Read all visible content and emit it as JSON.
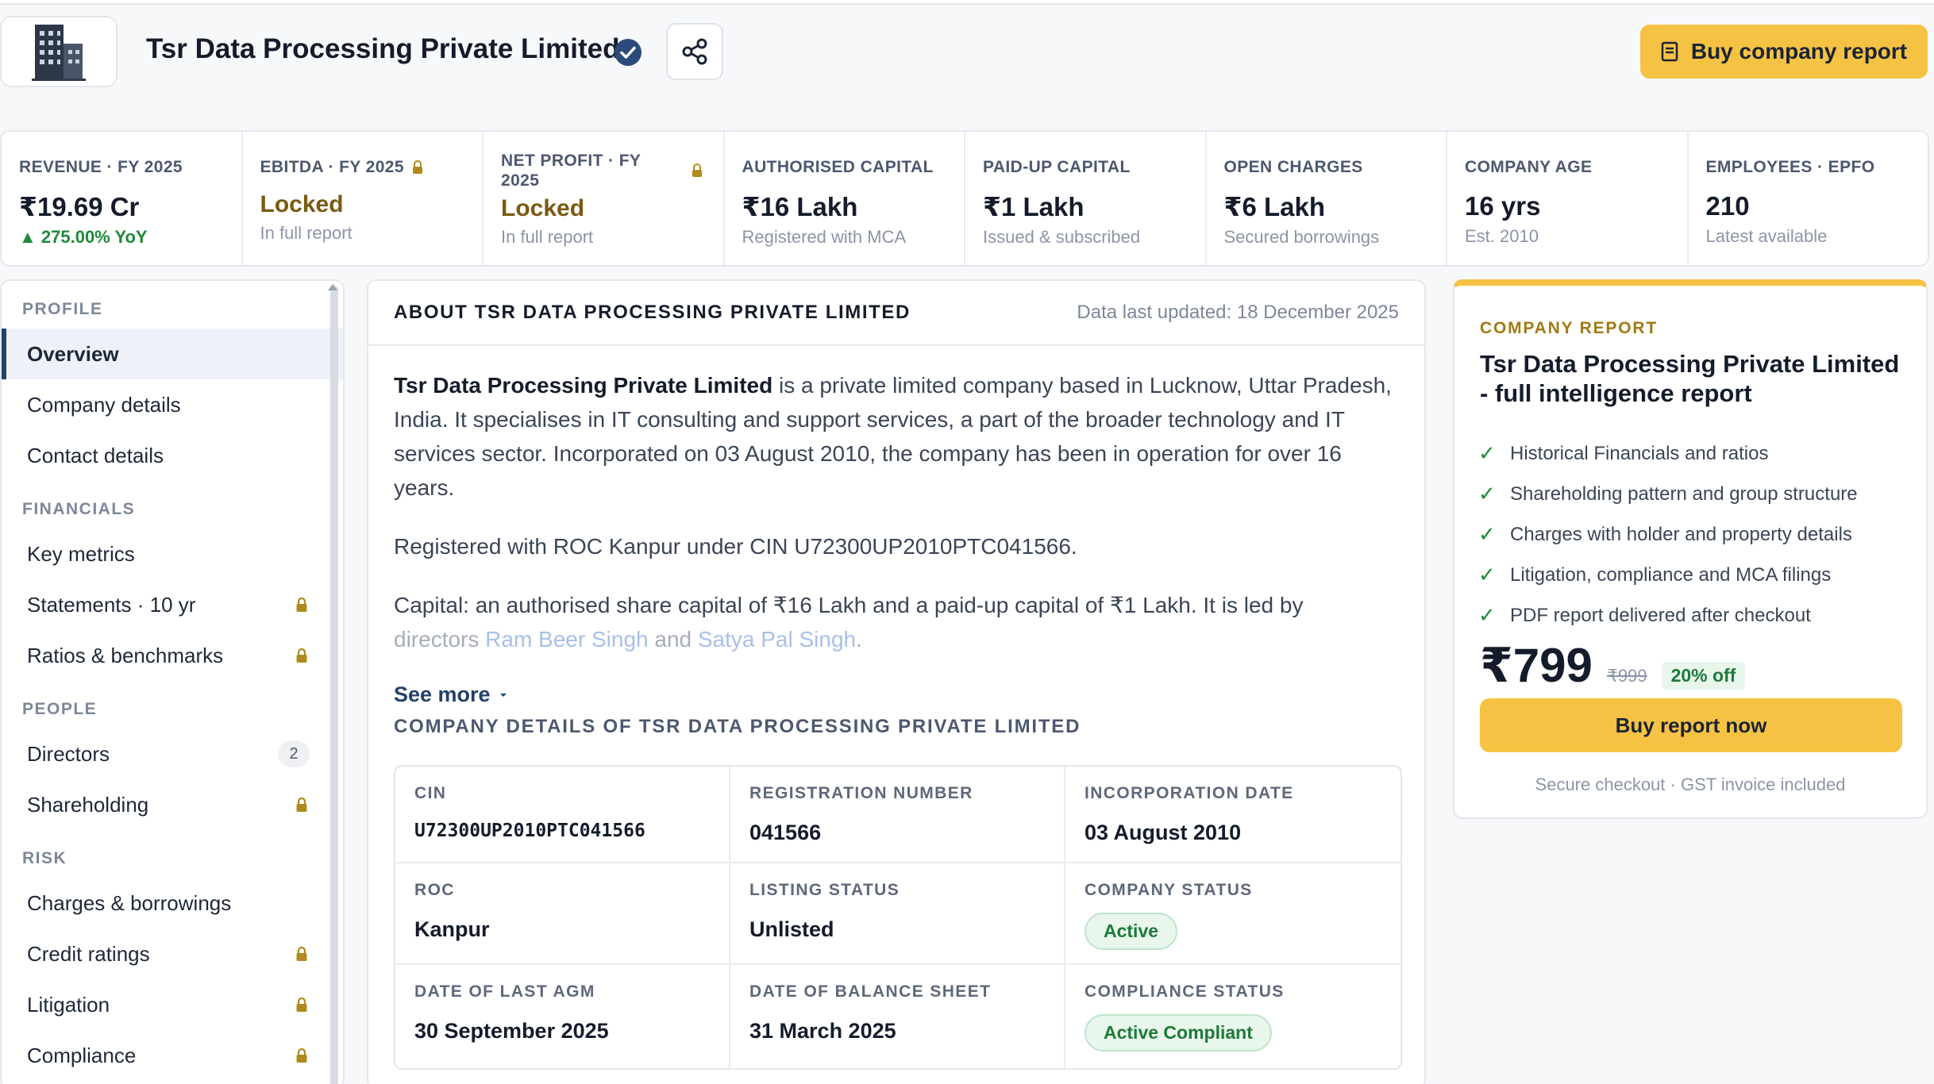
{
  "header": {
    "company_name": "Tsr Data Processing Private Limited",
    "buy_company_report_label": "Buy company report"
  },
  "metrics": [
    {
      "label": "REVENUE · FY 2025",
      "value": "₹19.69 Cr",
      "sub": "▲ 275.00% YoY"
    },
    {
      "label": "EBITDA · FY 2025",
      "value": "Locked",
      "sub": "In full report"
    },
    {
      "label": "NET PROFIT · FY 2025",
      "value": "Locked",
      "sub": "In full report"
    },
    {
      "label": "AUTHORISED CAPITAL",
      "value": "₹16 Lakh",
      "sub": "Registered with MCA"
    },
    {
      "label": "PAID-UP CAPITAL",
      "value": "₹1 Lakh",
      "sub": "Issued & subscribed"
    },
    {
      "label": "OPEN CHARGES",
      "value": "₹6 Lakh",
      "sub": "Secured borrowings"
    },
    {
      "label": "COMPANY AGE",
      "value": "16 yrs",
      "sub": "Est. 2010"
    },
    {
      "label": "EMPLOYEES · EPFO",
      "value": "210",
      "sub": "Latest available"
    }
  ],
  "sidebar": {
    "sections": [
      {
        "title": "PROFILE",
        "items": [
          {
            "label": "Overview"
          },
          {
            "label": "Company details"
          },
          {
            "label": "Contact details"
          }
        ]
      },
      {
        "title": "FINANCIALS",
        "items": [
          {
            "label": "Key metrics"
          },
          {
            "label": "Statements · 10 yr"
          },
          {
            "label": "Ratios & benchmarks"
          }
        ]
      },
      {
        "title": "PEOPLE",
        "items": [
          {
            "label": "Directors",
            "badge": "2"
          },
          {
            "label": "Shareholding"
          }
        ]
      },
      {
        "title": "RISK",
        "items": [
          {
            "label": "Charges & borrowings"
          },
          {
            "label": "Credit ratings"
          },
          {
            "label": "Litigation"
          },
          {
            "label": "Compliance"
          }
        ]
      }
    ]
  },
  "about": {
    "title": "ABOUT TSR DATA PROCESSING PRIVATE LIMITED",
    "updated": "Data last updated: 18 December 2025",
    "p1_bold": "Tsr Data Processing Private Limited",
    "p1_rest": " is a private limited company based in Lucknow, Uttar Pradesh, India. It specialises in IT consulting and support services, a part of the broader technology and IT services sector. Incorporated on 03 August 2010, the company has been in operation for over 16 years.",
    "p2": "Registered with ROC Kanpur under CIN U72300UP2010PTC041566.",
    "p3_start": "Capital: an authorised share capital of ₹16 Lakh and a paid-up capital of ₹1 Lakh. It is led by",
    "p3_directors": "directors",
    "p3_and": "and",
    "director1": "Ram Beer Singh",
    "director2": "Satya Pal Singh",
    "p3_end": ".",
    "see_more": "See more"
  },
  "details": {
    "title": "COMPANY DETAILS OF TSR DATA PROCESSING PRIVATE LIMITED",
    "cells": [
      {
        "label": "CIN",
        "value": "U72300UP2010PTC041566"
      },
      {
        "label": "REGISTRATION NUMBER",
        "value": "041566"
      },
      {
        "label": "INCORPORATION DATE",
        "value": "03 August 2010"
      },
      {
        "label": "ROC",
        "value": "Kanpur"
      },
      {
        "label": "LISTING STATUS",
        "value": "Unlisted"
      },
      {
        "label": "COMPANY STATUS",
        "value": "Active"
      },
      {
        "label": "DATE OF LAST AGM",
        "value": "30 September 2025"
      },
      {
        "label": "DATE OF BALANCE SHEET",
        "value": "31 March 2025"
      },
      {
        "label": "COMPLIANCE STATUS",
        "value": "Active Compliant"
      }
    ]
  },
  "report": {
    "kicker": "COMPANY REPORT",
    "title": "Tsr Data Processing Private Limited - full intelligence report",
    "features": [
      "Historical Financials and ratios",
      "Shareholding pattern and group structure",
      "Charges with holder and property details",
      "Litigation, compliance and MCA filings",
      "PDF report delivered after checkout"
    ],
    "check_glyph": "✓",
    "price": "₹799",
    "old_price": "₹999",
    "discount": "20% off",
    "buy_now_label": "Buy report now",
    "secure_text": "Secure checkout · GST invoice included"
  },
  "colors": {
    "accent": "#f6c244",
    "navy": "#23406b",
    "success": "#1f8a3b",
    "locked": "#7a5a12"
  }
}
